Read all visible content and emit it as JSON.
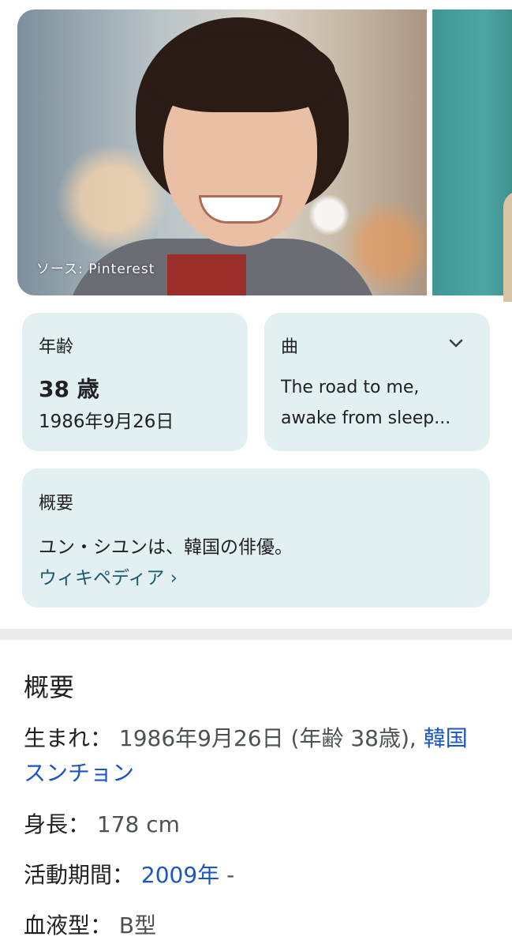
{
  "carousel": {
    "source_label": "ソース: Pinterest"
  },
  "age_card": {
    "label": "年齢",
    "value": "38 歳",
    "birthdate": "1986年9月26日"
  },
  "song_card": {
    "label": "曲",
    "line1": "The road to me,",
    "line2": "awake from sleep..."
  },
  "summary_card": {
    "label": "概要",
    "description": "ユン・シユンは、韓国の俳優。",
    "link_label": "ウィキペディア ›"
  },
  "details": {
    "title": "概要",
    "birth": {
      "key": "生まれ：",
      "value": "1986年9月26日 (年齢 38歳),",
      "place_part1": "韓国",
      "place_part2": "スンチョン"
    },
    "height": {
      "key": "身長：",
      "value": "178 cm"
    },
    "active": {
      "key": "活動期間：",
      "link": "2009年",
      "suffix": " -"
    },
    "blood": {
      "key": "血液型：",
      "value": "B型"
    }
  },
  "colors": {
    "card_bg": "#e3f0f2",
    "link_blue": "#1a56c4",
    "wiki_teal": "#1a5a6f"
  }
}
